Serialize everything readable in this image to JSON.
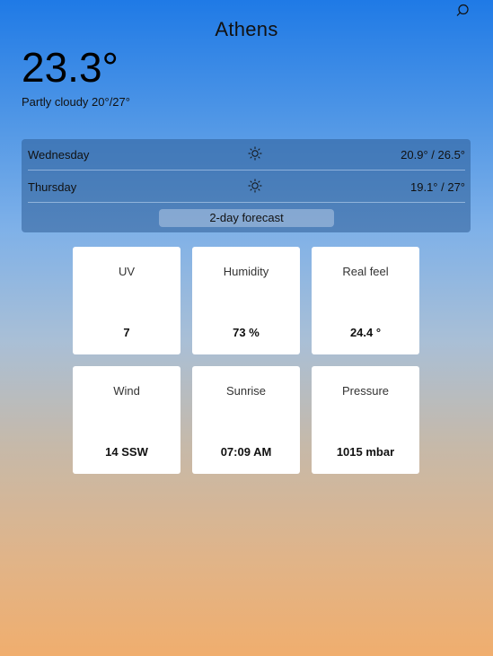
{
  "header": {
    "city": "Athens",
    "temperature": "23.3°",
    "condition": "Partly cloudy 20°/27°",
    "search_icon": "search-icon"
  },
  "forecast": {
    "days": [
      {
        "day": "Wednesday",
        "icon": "sun-icon",
        "range": "20.9° / 26.5°"
      },
      {
        "day": "Thursday",
        "icon": "sun-icon",
        "range": "19.1° / 27°"
      }
    ],
    "button_label": "2-day forecast"
  },
  "tiles": [
    {
      "label": "UV",
      "value": "7"
    },
    {
      "label": "Humidity",
      "value": "73 %"
    },
    {
      "label": "Real feel",
      "value": "24.4 °"
    },
    {
      "label": "Wind",
      "value": "14 SSW"
    },
    {
      "label": "Sunrise",
      "value": "07:09 AM"
    },
    {
      "label": "Pressure",
      "value": "1015 mbar"
    }
  ]
}
